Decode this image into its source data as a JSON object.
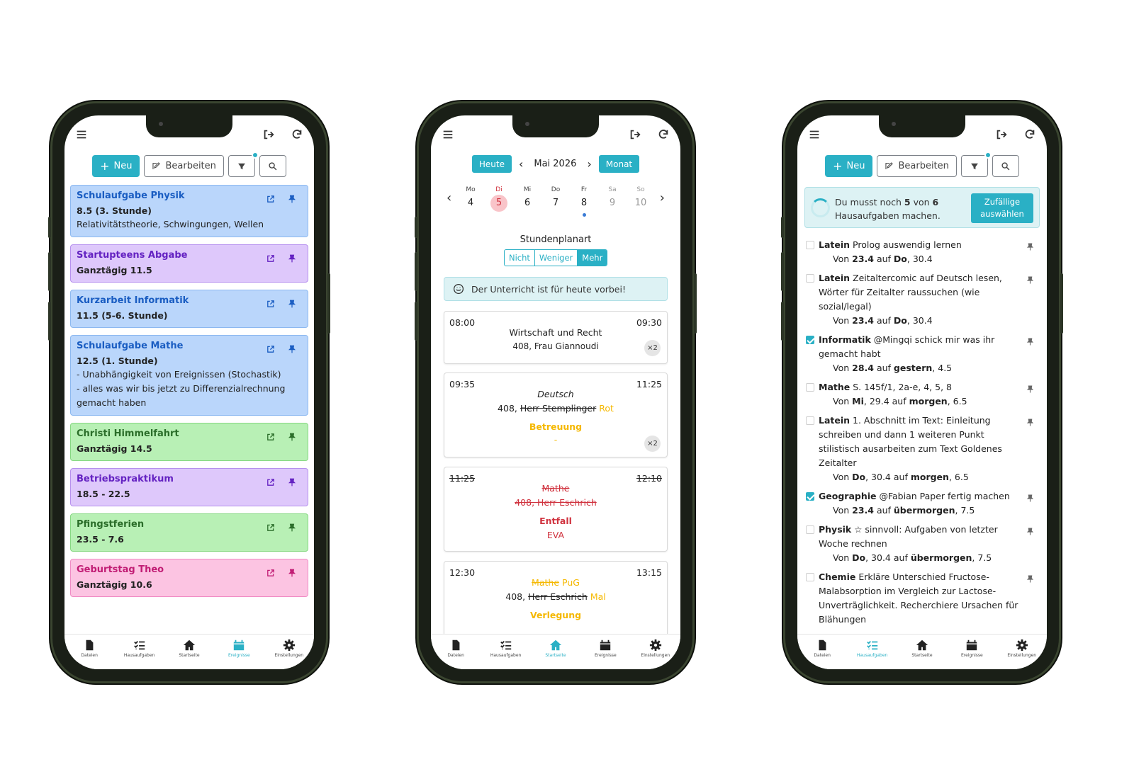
{
  "colors": {
    "accent": "#2ab0c5",
    "blue": "#bad6fb",
    "purple": "#dec8fb",
    "green": "#b8f0b5",
    "pink": "#fcc4e2",
    "yellow": "#f5b800",
    "red": "#d0323e"
  },
  "icons": {
    "menu": "menu-icon",
    "logout": "logout-icon",
    "refresh": "refresh-icon",
    "filter": "filter-icon",
    "search": "search-icon",
    "edit": "edit-icon",
    "share": "share-icon",
    "pin": "pin-icon"
  },
  "toolbar": {
    "new_label": "Neu",
    "edit_label": "Bearbeiten"
  },
  "nav": {
    "files": "Dateien",
    "homework": "Hausaufgaben",
    "home": "Startseite",
    "events": "Ereignisse",
    "settings": "Einstellungen"
  },
  "events": [
    {
      "title": "Schulaufgabe Physik",
      "sub": "8.5 (3. Stunde)",
      "desc": [
        "Relativitätstheorie, Schwingungen, Wellen"
      ],
      "color": "blue"
    },
    {
      "title": "Startupteens Abgabe",
      "sub": "Ganztägig 11.5",
      "desc": [],
      "color": "purple"
    },
    {
      "title": "Kurzarbeit Informatik",
      "sub": "11.5 (5-6. Stunde)",
      "desc": [],
      "color": "blue"
    },
    {
      "title": "Schulaufgabe Mathe",
      "sub": "12.5 (1. Stunde)",
      "desc": [
        "- Unabhängigkeit von Ereignissen (Stochastik)",
        "- alles was wir bis jetzt zu Differenzialrechnung gemacht haben"
      ],
      "color": "blue"
    },
    {
      "title": "Christi Himmelfahrt",
      "sub": "Ganztägig 14.5",
      "desc": [],
      "color": "green"
    },
    {
      "title": "Betriebspraktikum",
      "sub": "18.5 - 22.5",
      "desc": [],
      "color": "purple"
    },
    {
      "title": "Pfingstferien",
      "sub": "23.5 - 7.6",
      "desc": [],
      "color": "green"
    },
    {
      "title": "Geburtstag Theo",
      "sub": "Ganztägig 10.6",
      "desc": [],
      "color": "pink"
    }
  ],
  "calendar": {
    "today_label": "Heute",
    "month_label": "Mai 2026",
    "view_label": "Monat",
    "days": [
      {
        "wd": "Mo",
        "n": "4"
      },
      {
        "wd": "Di",
        "n": "5"
      },
      {
        "wd": "Mi",
        "n": "6"
      },
      {
        "wd": "Do",
        "n": "7"
      },
      {
        "wd": "Fr",
        "n": "8"
      },
      {
        "wd": "Sa",
        "n": "9"
      },
      {
        "wd": "So",
        "n": "10"
      }
    ],
    "schedule_type_label": "Stundenplanart",
    "schedule_options": [
      "Nicht",
      "Weniger",
      "Mehr"
    ],
    "info": "Der Unterricht ist für heute vorbei!",
    "lessons": {
      "l1": {
        "start": "08:00",
        "end": "09:30",
        "subject": "Wirtschaft und Recht",
        "room": "408, Frau Giannoudi",
        "badge": "×2"
      },
      "l2": {
        "start": "09:35",
        "end": "11:25",
        "subject": "Deutsch",
        "room": "408,",
        "old_teacher": "Herr Stemplinger",
        "new_teacher": "Rot",
        "status": "Betreuung",
        "note": "-",
        "badge": "×2"
      },
      "l3": {
        "start": "11:25",
        "end": "12:10",
        "subject": "Mathe",
        "room": "408, Herr Eschrich",
        "status": "Entfall",
        "note": "EVA"
      },
      "l4": {
        "start": "12:30",
        "end": "13:15",
        "old_subject": "Mathe",
        "new_subject": "PuG",
        "room": "408,",
        "old_teacher": "Herr Eschrich",
        "new_teacher": "Mal",
        "status": "Verlegung"
      }
    }
  },
  "homework": {
    "banner_pre": "Du musst noch",
    "banner_open": "5",
    "banner_mid": "von",
    "banner_total": "6",
    "banner_post": "Hausaufgaben machen.",
    "random_button": "Zufällige auswählen",
    "items": [
      {
        "subject": "Latein",
        "text": "Prolog auswendig lernen",
        "from": "23.4",
        "to": "Do",
        "to_date": "30.4",
        "done": false
      },
      {
        "subject": "Latein",
        "text": "Zeitaltercomic auf Deutsch lesen, Wörter für Zeitalter raussuchen (wie sozial/legal)",
        "from": "23.4",
        "to": "Do",
        "to_date": "30.4",
        "done": false
      },
      {
        "subject": "Informatik",
        "text": "@Mingqi schick mir was ihr gemacht habt",
        "from": "28.4",
        "to": "gestern",
        "to_date": "4.5",
        "done": true
      },
      {
        "subject": "Mathe",
        "text": "S. 145f/1, 2a-e, 4, 5, 8",
        "from": "Mi",
        "from_date": "29.4",
        "to": "morgen",
        "to_date": "6.5",
        "done": false
      },
      {
        "subject": "Latein",
        "text": "1. Abschnitt im Text: Einleitung schreiben und dann 1 weiteren Punkt stilistisch ausarbeiten zum Text Goldenes Zeitalter",
        "from": "Do",
        "from_date": "30.4",
        "to": "morgen",
        "to_date": "6.5",
        "done": false
      },
      {
        "subject": "Geographie",
        "text": "@Fabian Paper fertig machen",
        "from": "23.4",
        "to": "übermorgen",
        "to_date": "7.5",
        "done": true
      },
      {
        "subject": "Physik",
        "text": "☆ sinnvoll: Aufgaben von letzter Woche rechnen",
        "from": "Do",
        "from_date": "30.4",
        "to": "übermorgen",
        "to_date": "7.5",
        "done": false
      },
      {
        "subject": "Chemie",
        "text": "Erkläre Unterschied Fructose-Malabsorption im Vergleich zur Lactose-Unverträglichkeit. Recherchiere Ursachen für Blähungen",
        "done": false
      }
    ]
  }
}
